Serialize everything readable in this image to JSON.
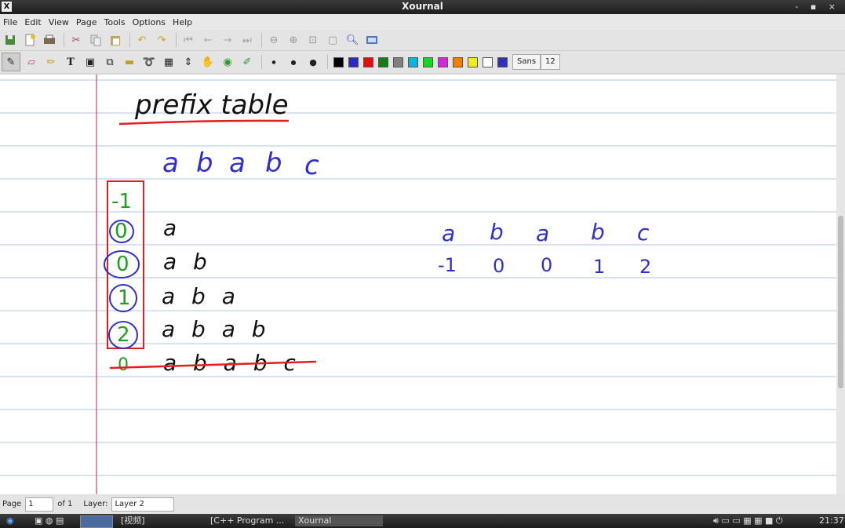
{
  "window": {
    "title": "Xournal",
    "icon": "X",
    "controls": "- ▪ ×"
  },
  "menu": [
    "File",
    "Edit",
    "View",
    "Page",
    "Tools",
    "Options",
    "Help"
  ],
  "toolbar1": {
    "icons": [
      "save-icon",
      "new-page-icon",
      "print-icon",
      "cut-icon",
      "copy-icon",
      "paste-icon",
      "undo-icon",
      "redo-icon",
      "first-page-icon",
      "prev-page-icon",
      "next-page-icon",
      "last-page-icon",
      "zoom-out-icon",
      "zoom-in-icon",
      "zoom-fit-icon",
      "zoom-100-icon",
      "find-icon",
      "fullscreen-icon"
    ]
  },
  "toolbar2": {
    "tools": [
      "pen-icon",
      "eraser-icon",
      "highlighter-icon",
      "text-icon",
      "image-icon",
      "shape-icon",
      "ruler-icon",
      "lasso-icon",
      "rect-select-icon",
      "vertical-space-icon",
      "hand-icon",
      "default-pen-icon",
      "default-highlighter-icon"
    ],
    "colors": [
      "#000000",
      "#2a2ac8",
      "#e01010",
      "#108010",
      "#808080",
      "#10b0e0",
      "#20d020",
      "#e020e0",
      "#f08000",
      "#f0f000",
      "#ffffff",
      "#3030c0"
    ],
    "font_name": "Sans",
    "font_size": "12"
  },
  "canvas": {
    "heading": "prefix table",
    "pattern_letters": [
      "a",
      "b",
      "a",
      "b",
      "c"
    ],
    "table_values": [
      "-1",
      "0",
      "0",
      "1",
      "2",
      "0"
    ],
    "prefixes": [
      "a",
      "a b",
      "a b a",
      "a b a b",
      "a b a b c"
    ],
    "right_letters": [
      "a",
      "b",
      "a",
      "b",
      "c"
    ],
    "right_values": [
      "-1",
      "0",
      "0",
      "1",
      "2"
    ],
    "colors": {
      "black": "#111111",
      "blue": "#2f2fd0",
      "green": "#1e9e1e",
      "red": "#e02020",
      "rule": "#aac8ee",
      "margin": "#d04080"
    }
  },
  "status": {
    "page_label": "Page",
    "page_value": "1",
    "of_label": "of 1",
    "layer_label": "Layer:",
    "layer_value": "Layer 2"
  },
  "taskbar": {
    "task1": "[视频]",
    "task2": "[C++ Program ...",
    "task3": "Xournal",
    "clock": "21:37"
  }
}
